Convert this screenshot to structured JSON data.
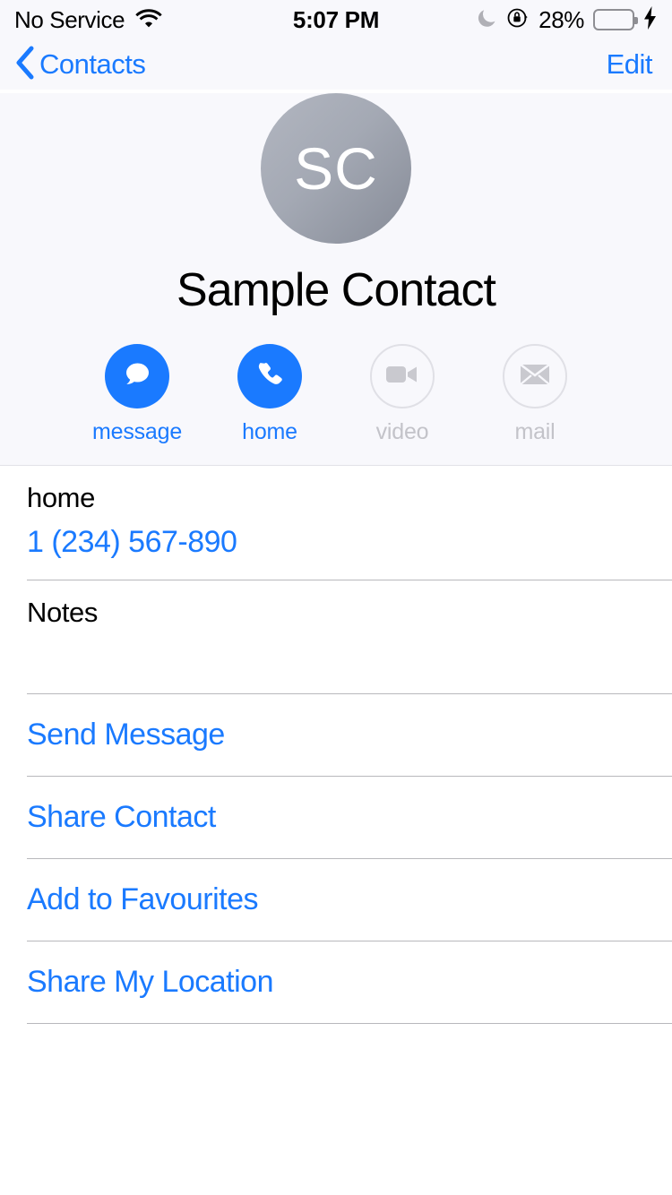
{
  "status_bar": {
    "carrier": "No Service",
    "wifi_icon": "wifi-icon",
    "time": "5:07 PM",
    "do_not_disturb_icon": "moon-icon",
    "rotation_lock_icon": "rotation-lock-icon",
    "battery_percent": "28%",
    "battery_level": 28,
    "charging_icon": "lightning-bolt-icon",
    "battery_color": "#4cd964"
  },
  "nav_bar": {
    "back_icon": "chevron-left-icon",
    "back_label": "Contacts",
    "edit_label": "Edit"
  },
  "contact": {
    "initials": "SC",
    "name": "Sample Contact",
    "avatar_gradient_start": "#b2b6c0",
    "avatar_gradient_end": "#868b97"
  },
  "quick_actions": [
    {
      "label": "message",
      "icon": "message-bubble-icon",
      "enabled": true
    },
    {
      "label": "home",
      "icon": "phone-handset-icon",
      "enabled": true
    },
    {
      "label": "video",
      "icon": "video-camera-icon",
      "enabled": false
    },
    {
      "label": "mail",
      "icon": "envelope-icon",
      "enabled": false
    }
  ],
  "fields": {
    "phone_label": "home",
    "phone_value": "1 (234) 567-890",
    "notes_label": "Notes",
    "notes_value": ""
  },
  "action_rows": [
    {
      "label": "Send Message"
    },
    {
      "label": "Share Contact"
    },
    {
      "label": "Add to Favourites"
    },
    {
      "label": "Share My Location"
    }
  ],
  "colors": {
    "accent_blue": "#1a7aff",
    "header_bg": "#f8f8fc",
    "separator": "#b8b8bc",
    "disabled_gray": "#c3c3c9"
  }
}
